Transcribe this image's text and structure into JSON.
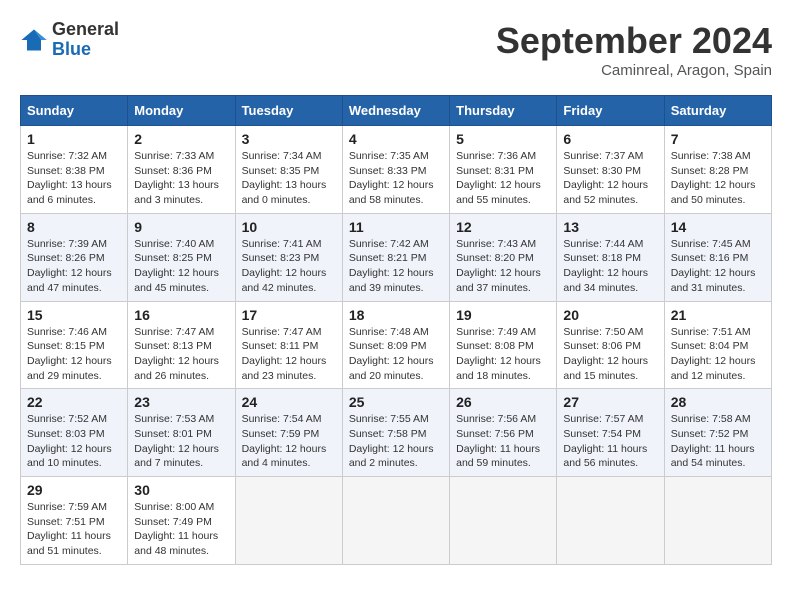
{
  "header": {
    "logo_general": "General",
    "logo_blue": "Blue",
    "month_title": "September 2024",
    "location": "Caminreal, Aragon, Spain"
  },
  "calendar": {
    "headers": [
      "Sunday",
      "Monday",
      "Tuesday",
      "Wednesday",
      "Thursday",
      "Friday",
      "Saturday"
    ],
    "weeks": [
      [
        {
          "day": "",
          "empty": true
        },
        {
          "day": "",
          "empty": true
        },
        {
          "day": "",
          "empty": true
        },
        {
          "day": "",
          "empty": true
        },
        {
          "day": "",
          "empty": true
        },
        {
          "day": "",
          "empty": true
        },
        {
          "day": "",
          "empty": true
        }
      ],
      [
        {
          "day": "1",
          "sunrise": "7:32 AM",
          "sunset": "8:38 PM",
          "daylight": "13 hours and 6 minutes."
        },
        {
          "day": "2",
          "sunrise": "7:33 AM",
          "sunset": "8:36 PM",
          "daylight": "13 hours and 3 minutes."
        },
        {
          "day": "3",
          "sunrise": "7:34 AM",
          "sunset": "8:35 PM",
          "daylight": "13 hours and 0 minutes."
        },
        {
          "day": "4",
          "sunrise": "7:35 AM",
          "sunset": "8:33 PM",
          "daylight": "12 hours and 58 minutes."
        },
        {
          "day": "5",
          "sunrise": "7:36 AM",
          "sunset": "8:31 PM",
          "daylight": "12 hours and 55 minutes."
        },
        {
          "day": "6",
          "sunrise": "7:37 AM",
          "sunset": "8:30 PM",
          "daylight": "12 hours and 52 minutes."
        },
        {
          "day": "7",
          "sunrise": "7:38 AM",
          "sunset": "8:28 PM",
          "daylight": "12 hours and 50 minutes."
        }
      ],
      [
        {
          "day": "8",
          "sunrise": "7:39 AM",
          "sunset": "8:26 PM",
          "daylight": "12 hours and 47 minutes."
        },
        {
          "day": "9",
          "sunrise": "7:40 AM",
          "sunset": "8:25 PM",
          "daylight": "12 hours and 45 minutes."
        },
        {
          "day": "10",
          "sunrise": "7:41 AM",
          "sunset": "8:23 PM",
          "daylight": "12 hours and 42 minutes."
        },
        {
          "day": "11",
          "sunrise": "7:42 AM",
          "sunset": "8:21 PM",
          "daylight": "12 hours and 39 minutes."
        },
        {
          "day": "12",
          "sunrise": "7:43 AM",
          "sunset": "8:20 PM",
          "daylight": "12 hours and 37 minutes."
        },
        {
          "day": "13",
          "sunrise": "7:44 AM",
          "sunset": "8:18 PM",
          "daylight": "12 hours and 34 minutes."
        },
        {
          "day": "14",
          "sunrise": "7:45 AM",
          "sunset": "8:16 PM",
          "daylight": "12 hours and 31 minutes."
        }
      ],
      [
        {
          "day": "15",
          "sunrise": "7:46 AM",
          "sunset": "8:15 PM",
          "daylight": "12 hours and 29 minutes."
        },
        {
          "day": "16",
          "sunrise": "7:47 AM",
          "sunset": "8:13 PM",
          "daylight": "12 hours and 26 minutes."
        },
        {
          "day": "17",
          "sunrise": "7:47 AM",
          "sunset": "8:11 PM",
          "daylight": "12 hours and 23 minutes."
        },
        {
          "day": "18",
          "sunrise": "7:48 AM",
          "sunset": "8:09 PM",
          "daylight": "12 hours and 20 minutes."
        },
        {
          "day": "19",
          "sunrise": "7:49 AM",
          "sunset": "8:08 PM",
          "daylight": "12 hours and 18 minutes."
        },
        {
          "day": "20",
          "sunrise": "7:50 AM",
          "sunset": "8:06 PM",
          "daylight": "12 hours and 15 minutes."
        },
        {
          "day": "21",
          "sunrise": "7:51 AM",
          "sunset": "8:04 PM",
          "daylight": "12 hours and 12 minutes."
        }
      ],
      [
        {
          "day": "22",
          "sunrise": "7:52 AM",
          "sunset": "8:03 PM",
          "daylight": "12 hours and 10 minutes."
        },
        {
          "day": "23",
          "sunrise": "7:53 AM",
          "sunset": "8:01 PM",
          "daylight": "12 hours and 7 minutes."
        },
        {
          "day": "24",
          "sunrise": "7:54 AM",
          "sunset": "7:59 PM",
          "daylight": "12 hours and 4 minutes."
        },
        {
          "day": "25",
          "sunrise": "7:55 AM",
          "sunset": "7:58 PM",
          "daylight": "12 hours and 2 minutes."
        },
        {
          "day": "26",
          "sunrise": "7:56 AM",
          "sunset": "7:56 PM",
          "daylight": "11 hours and 59 minutes."
        },
        {
          "day": "27",
          "sunrise": "7:57 AM",
          "sunset": "7:54 PM",
          "daylight": "11 hours and 56 minutes."
        },
        {
          "day": "28",
          "sunrise": "7:58 AM",
          "sunset": "7:52 PM",
          "daylight": "11 hours and 54 minutes."
        }
      ],
      [
        {
          "day": "29",
          "sunrise": "7:59 AM",
          "sunset": "7:51 PM",
          "daylight": "11 hours and 51 minutes."
        },
        {
          "day": "30",
          "sunrise": "8:00 AM",
          "sunset": "7:49 PM",
          "daylight": "11 hours and 48 minutes."
        },
        {
          "day": "",
          "empty": true
        },
        {
          "day": "",
          "empty": true
        },
        {
          "day": "",
          "empty": true
        },
        {
          "day": "",
          "empty": true
        },
        {
          "day": "",
          "empty": true
        }
      ]
    ]
  }
}
